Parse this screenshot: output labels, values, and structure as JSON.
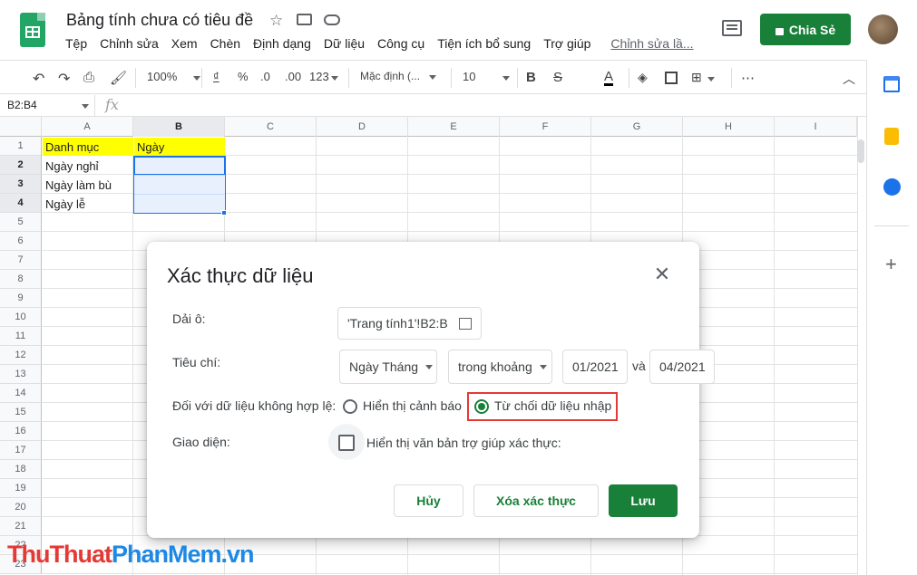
{
  "app": {
    "doc_title": "Bảng tính chưa có tiêu đề",
    "menu": [
      "Tệp",
      "Chỉnh sửa",
      "Xem",
      "Chèn",
      "Định dạng",
      "Dữ liệu",
      "Công cụ",
      "Tiện ích bổ sung",
      "Trợ giúp"
    ],
    "last_edit": "Chỉnh sửa lầ...",
    "share_label": "Chia Sẻ"
  },
  "toolbar": {
    "zoom": "100%",
    "currency": "₫",
    "percent": "%",
    "dec_decrease": ".0",
    "dec_increase": ".00",
    "more_formats": "123",
    "font": "Mặc định (...",
    "font_size": "10",
    "bold": "B",
    "strike": "S",
    "text_color": "A"
  },
  "formula_bar": {
    "name_box": "B2:B4",
    "fx": "fx"
  },
  "grid": {
    "columns": [
      "A",
      "B",
      "C",
      "D",
      "E",
      "F",
      "G",
      "H",
      "I"
    ],
    "rows": [
      "1",
      "2",
      "3",
      "4",
      "5",
      "6",
      "7",
      "8",
      "9",
      "10",
      "11",
      "12",
      "13",
      "14",
      "15",
      "16",
      "17",
      "18",
      "19",
      "20",
      "21",
      "22",
      "23"
    ],
    "cells": {
      "A1": "Danh mục",
      "B1": "Ngày",
      "A2": "Ngày nghỉ",
      "A3": "Ngày làm bù",
      "A4": "Ngày lễ"
    },
    "header_fill": "#ffff00",
    "selection_fill": "#e8f0fe",
    "selection_border": "#1a73e8"
  },
  "dialog": {
    "title": "Xác thực dữ liệu",
    "range_label": "Dải ô:",
    "range_value": "'Trang tính1'!B2:B",
    "criteria_label": "Tiêu chí:",
    "criteria_type": "Ngày Tháng",
    "criteria_op": "trong khoảng",
    "date_from": "01/2021",
    "and_label": "và",
    "date_to": "04/2021",
    "invalid_label": "Đối với dữ liệu không hợp lệ:",
    "option_warn": "Hiển thị cảnh báo",
    "option_reject": "Từ chối dữ liệu nhập",
    "appearance_label": "Giao diện:",
    "help_text_label": "Hiển thị văn bản trợ giúp xác thực:",
    "cancel": "Hủy",
    "remove": "Xóa xác thực",
    "save": "Lưu",
    "accent": "#188038",
    "highlight": "#e53935"
  },
  "watermark": {
    "part1": "Thu",
    "part2": "Thuat",
    "part3": "Phan",
    "part4": "Mem",
    "part5": ".vn"
  }
}
